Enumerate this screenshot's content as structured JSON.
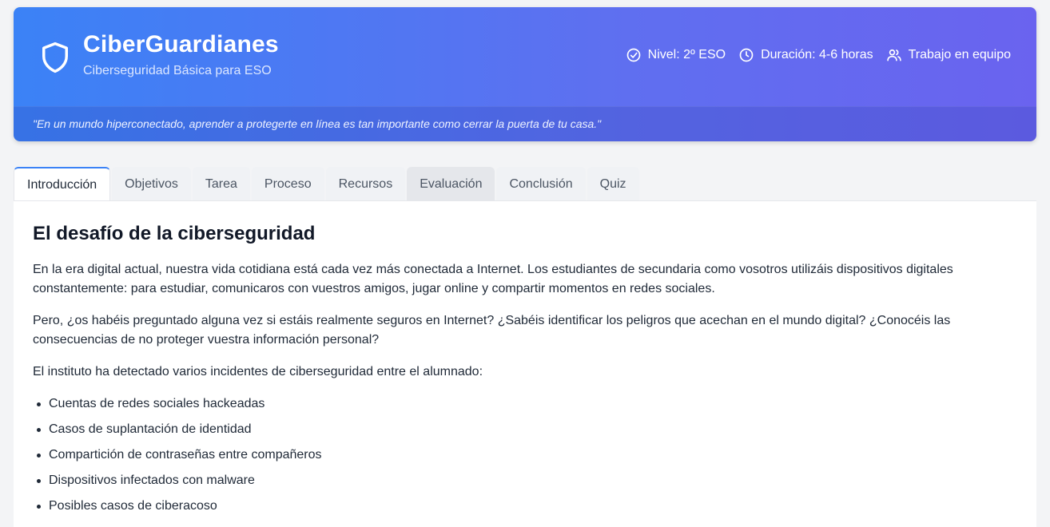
{
  "header": {
    "title": "CiberGuardianes",
    "subtitle": "Ciberseguridad Básica para ESO",
    "brand_icon": "shield-icon",
    "meta": {
      "level": "Nivel: 2º ESO",
      "duration": "Duración: 4-6 horas",
      "teamwork": "Trabajo en equipo"
    },
    "quote": "\"En un mundo hiperconectado, aprender a protegerte en línea es tan importante como cerrar la puerta de tu casa.\""
  },
  "tabs": [
    {
      "label": "Introducción",
      "active": true
    },
    {
      "label": "Objetivos"
    },
    {
      "label": "Tarea"
    },
    {
      "label": "Proceso"
    },
    {
      "label": "Recursos"
    },
    {
      "label": "Evaluación",
      "hover": true
    },
    {
      "label": "Conclusión"
    },
    {
      "label": "Quiz"
    }
  ],
  "content": {
    "heading": "El desafío de la ciberseguridad",
    "paragraphs": [
      "En la era digital actual, nuestra vida cotidiana está cada vez más conectada a Internet. Los estudiantes de secundaria como vosotros utilizáis dispositivos digitales constantemente: para estudiar, comunicaros con vuestros amigos, jugar online y compartir momentos en redes sociales.",
      "Pero, ¿os habéis preguntado alguna vez si estáis realmente seguros en Internet? ¿Sabéis identificar los peligros que acechan en el mundo digital? ¿Conocéis las consecuencias de no proteger vuestra información personal?",
      "El instituto ha detectado varios incidentes de ciberseguridad entre el alumnado:"
    ],
    "incidents": [
      "Cuentas de redes sociales hackeadas",
      "Casos de suplantación de identidad",
      "Compartición de contraseñas entre compañeros",
      "Dispositivos infectados con malware",
      "Posibles casos de ciberacoso"
    ]
  },
  "colors": {
    "header_gradient_start": "#3b82f6",
    "header_gradient_end": "#6a63ef",
    "active_tab_accent": "#3b82f6",
    "page_background": "#f3f4f6"
  }
}
